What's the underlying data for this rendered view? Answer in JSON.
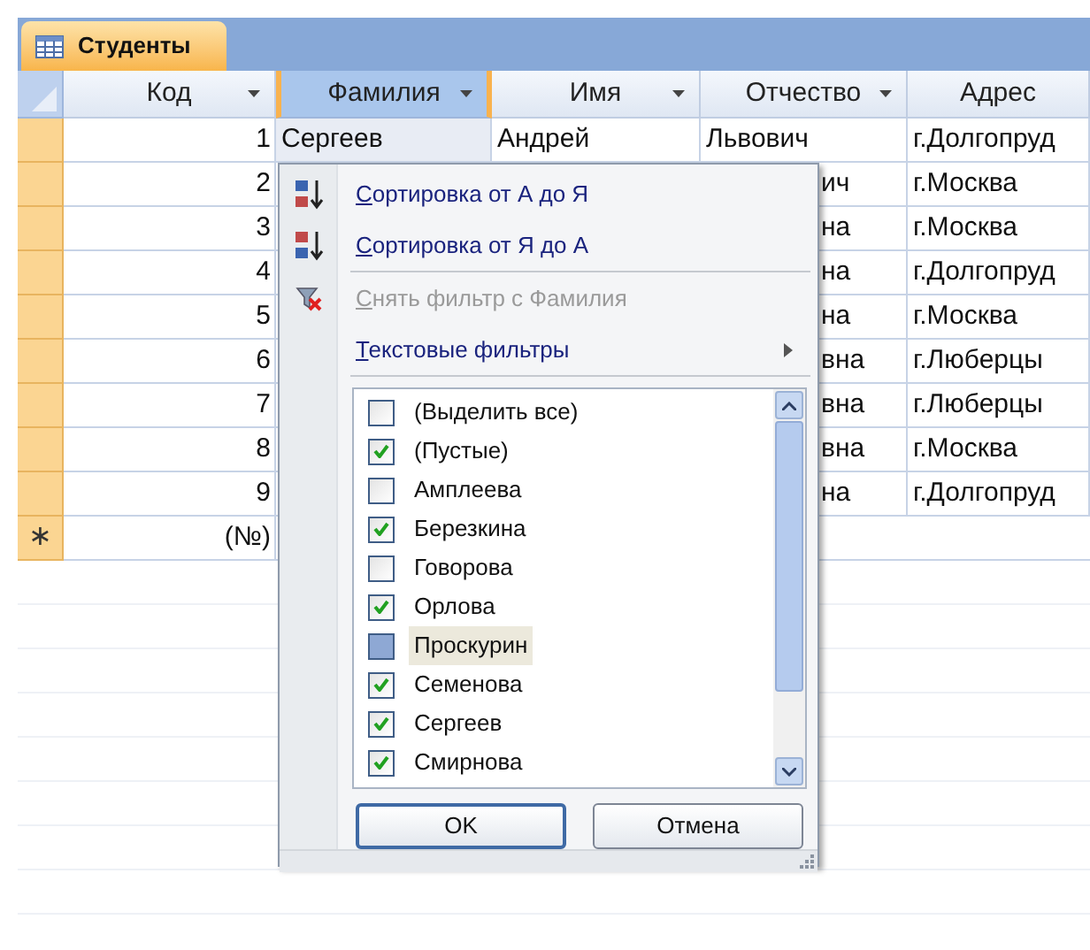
{
  "tab": {
    "title": "Студенты",
    "selected": true
  },
  "columns": [
    {
      "label": "Код",
      "selected": false,
      "dropdown": true
    },
    {
      "label": "Фамилия",
      "selected": true,
      "dropdown": true
    },
    {
      "label": "Имя",
      "selected": false,
      "dropdown": true
    },
    {
      "label": "Отчество",
      "selected": false,
      "dropdown": true
    },
    {
      "label": "Адрес",
      "selected": false,
      "dropdown": false
    }
  ],
  "rows": [
    {
      "cells": [
        "1",
        "Сергеев",
        "Андрей",
        "Львович",
        "г.Долгопруд"
      ]
    },
    {
      "cells": [
        "2",
        null,
        null,
        "ич",
        "г.Москва"
      ]
    },
    {
      "cells": [
        "3",
        null,
        null,
        "на",
        "г.Москва"
      ]
    },
    {
      "cells": [
        "4",
        null,
        null,
        "на",
        "г.Долгопруд"
      ]
    },
    {
      "cells": [
        "5",
        null,
        null,
        "на",
        "г.Москва"
      ]
    },
    {
      "cells": [
        "6",
        null,
        null,
        "вна",
        "г.Люберцы"
      ]
    },
    {
      "cells": [
        "7",
        null,
        null,
        "вна",
        "г.Люберцы"
      ]
    },
    {
      "cells": [
        "8",
        null,
        null,
        "вна",
        "г.Москва"
      ]
    },
    {
      "cells": [
        "9",
        null,
        null,
        "на",
        "г.Долгопруд"
      ]
    }
  ],
  "new_row": {
    "marker": "∗",
    "kod": "(№)"
  },
  "filter_menu": {
    "items": [
      {
        "kind": "sort_asc",
        "label": "Сортировка от А до Я",
        "disabled": false
      },
      {
        "kind": "sort_desc",
        "label": "Сортировка от Я до А",
        "disabled": false
      },
      {
        "kind": "clear_filter",
        "label": "Снять фильтр с Фамилия",
        "disabled": true
      },
      {
        "kind": "submenu",
        "label": "Текстовые фильтры",
        "disabled": false
      }
    ],
    "values": [
      {
        "label": "(Выделить все)",
        "checked": false,
        "highlighted": false
      },
      {
        "label": "(Пустые)",
        "checked": true,
        "highlighted": false
      },
      {
        "label": "Амплеева",
        "checked": false,
        "highlighted": false
      },
      {
        "label": "Березкина",
        "checked": true,
        "highlighted": false
      },
      {
        "label": "Говорова",
        "checked": false,
        "highlighted": false
      },
      {
        "label": "Орлова",
        "checked": true,
        "highlighted": false
      },
      {
        "label": "Проскурин",
        "checked": false,
        "highlighted": true
      },
      {
        "label": "Семенова",
        "checked": true,
        "highlighted": false
      },
      {
        "label": "Сергеев",
        "checked": true,
        "highlighted": false
      },
      {
        "label": "Смирнова",
        "checked": true,
        "highlighted": false
      }
    ],
    "buttons": [
      "OK",
      "Отмена"
    ]
  }
}
